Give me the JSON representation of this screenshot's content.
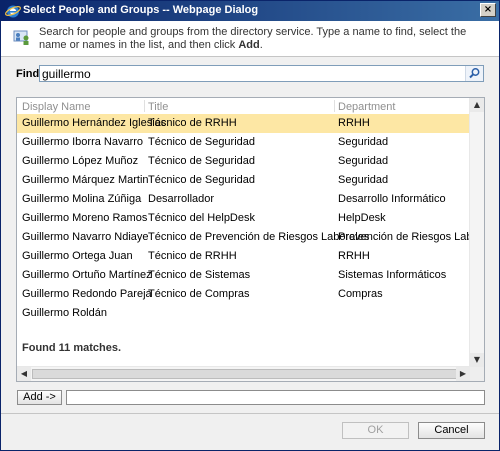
{
  "window": {
    "title": "Select People and Groups -- Webpage Dialog",
    "close_label": "×"
  },
  "info": {
    "text_before": "Search for people and groups from the directory service. Type a name to find, select the name or names in the list, and then click ",
    "text_bold": "Add",
    "text_after": "."
  },
  "find": {
    "label": "Find",
    "value": "guillermo"
  },
  "results": {
    "columns": [
      "Display Name",
      "Title",
      "Department"
    ],
    "rows": [
      {
        "name": "Guillermo Hernández Iglesias",
        "title": "Técnico de RRHH",
        "department": "RRHH",
        "selected": true
      },
      {
        "name": "Guillermo Iborra Navarro",
        "title": "Técnico de Seguridad",
        "department": "Seguridad"
      },
      {
        "name": "Guillermo López Muñoz",
        "title": "Técnico de Seguridad",
        "department": "Seguridad"
      },
      {
        "name": "Guillermo Márquez Martin",
        "title": "Técnico de Seguridad",
        "department": "Seguridad"
      },
      {
        "name": "Guillermo Molina Zúñiga",
        "title": "Desarrollador",
        "department": "Desarrollo Informático"
      },
      {
        "name": "Guillermo Moreno Ramos",
        "title": "Técnico del HelpDesk",
        "department": "HelpDesk"
      },
      {
        "name": "Guillermo Navarro Ndiaye",
        "title": "Técnico de Prevención de Riesgos Laborales",
        "department": "Prevención de Riesgos Laborales"
      },
      {
        "name": "Guillermo Ortega Juan",
        "title": "Técnico de RRHH",
        "department": "RRHH"
      },
      {
        "name": "Guillermo Ortuño Martínez",
        "title": "Técnico de Sistemas",
        "department": "Sistemas Informáticos"
      },
      {
        "name": "Guillermo Redondo Pareja",
        "title": "Técnico de Compras",
        "department": "Compras"
      },
      {
        "name": "Guillermo Roldán",
        "title": "",
        "department": ""
      }
    ],
    "found_text": "Found 11 matches."
  },
  "add": {
    "button_label": "Add ->",
    "value": ""
  },
  "buttons": {
    "ok": "OK",
    "cancel": "Cancel"
  },
  "colors": {
    "title_bar": "#0a246a",
    "selected_row": "#fde7a4"
  }
}
